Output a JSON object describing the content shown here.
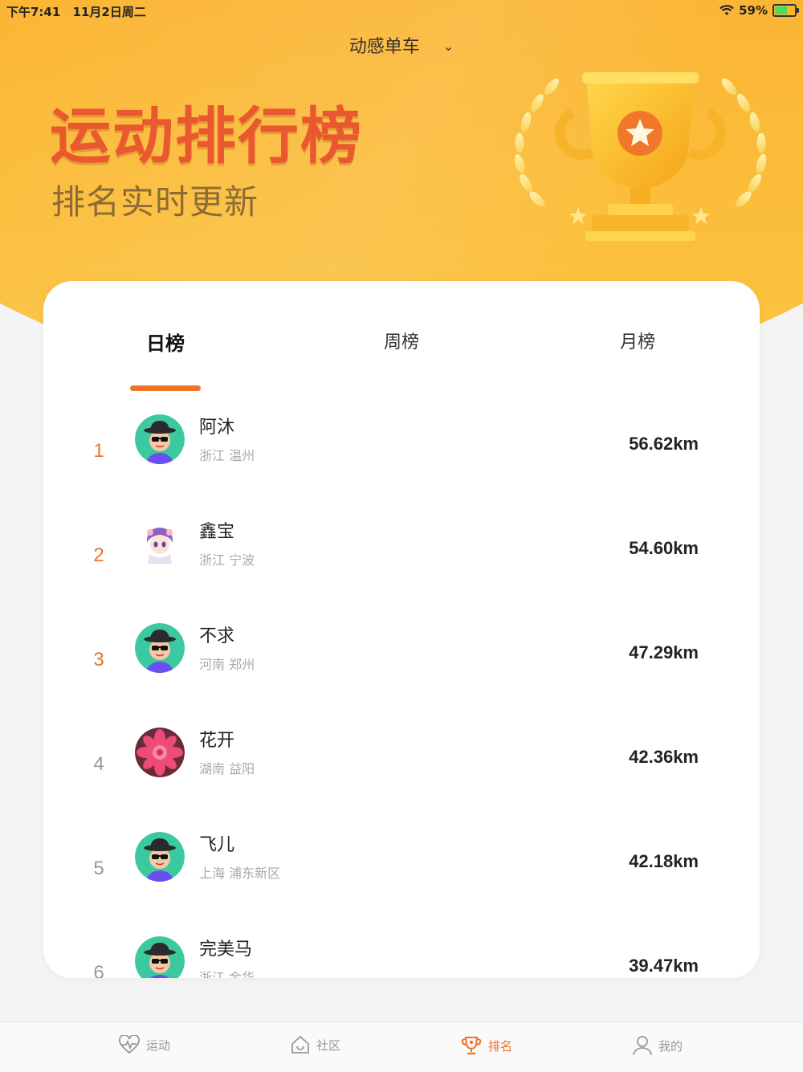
{
  "status_bar": {
    "time": "下午7:41",
    "date": "11月2日周二",
    "battery": "59%",
    "battery_level": 0.59
  },
  "header": {
    "selector_label": "动感单车",
    "title": "运动排行榜",
    "subtitle": "排名实时更新"
  },
  "tabs": [
    {
      "label": "日榜",
      "active": true
    },
    {
      "label": "周榜",
      "active": false
    },
    {
      "label": "月榜",
      "active": false
    }
  ],
  "rankings": [
    {
      "rank": "1",
      "name": "阿沐",
      "location": "浙江 温州",
      "distance": "56.62km",
      "avatar": "sunglasses-man"
    },
    {
      "rank": "2",
      "name": "鑫宝",
      "location": "浙江 宁波",
      "distance": "54.60km",
      "avatar": "anime-girl"
    },
    {
      "rank": "3",
      "name": "不求",
      "location": "河南 郑州",
      "distance": "47.29km",
      "avatar": "sunglasses-man"
    },
    {
      "rank": "4",
      "name": "花开",
      "location": "湖南 益阳",
      "distance": "42.36km",
      "avatar": "pink-flower"
    },
    {
      "rank": "5",
      "name": "飞儿",
      "location": "上海 浦东新区",
      "distance": "42.18km",
      "avatar": "sunglasses-man"
    },
    {
      "rank": "6",
      "name": "完美马",
      "location": "浙江 金华",
      "distance": "39.47km",
      "avatar": "sunglasses-man"
    }
  ],
  "bottom_nav": [
    {
      "label": "运动",
      "icon": "heartbeat-icon",
      "active": false
    },
    {
      "label": "社区",
      "icon": "home-icon",
      "active": false
    },
    {
      "label": "排名",
      "icon": "trophy-icon",
      "active": true
    },
    {
      "label": "我的",
      "icon": "user-icon",
      "active": false
    }
  ],
  "colors": {
    "accent": "#f0722b",
    "hero": "#fbb534",
    "title": "#e9582f"
  }
}
